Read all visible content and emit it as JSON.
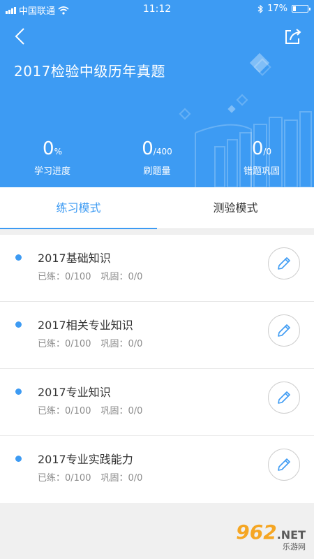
{
  "statusbar": {
    "carrier": "中国联通",
    "time": "11:12",
    "battery": "17%"
  },
  "header": {
    "title": "2017检验中级历年真题",
    "back_icon": "back-chevron-icon",
    "share_icon": "share-icon",
    "stats": [
      {
        "value": "0",
        "unit": "%",
        "label": "学习进度"
      },
      {
        "value": "0",
        "unit": "/400",
        "label": "刷题量"
      },
      {
        "value": "0",
        "unit": "/0",
        "label": "错题巩固"
      }
    ]
  },
  "tabs": [
    {
      "label": "练习模式",
      "active": true
    },
    {
      "label": "测验模式",
      "active": false
    }
  ],
  "items": [
    {
      "title": "2017基础知识",
      "practiced": "已练：0/100",
      "consolidated": "巩固：0/0"
    },
    {
      "title": "2017相关专业知识",
      "practiced": "已练：0/100",
      "consolidated": "巩固：0/0"
    },
    {
      "title": " 2017专业知识",
      "practiced": "已练：0/100",
      "consolidated": "巩固：0/0"
    },
    {
      "title": " 2017专业实践能力",
      "practiced": "已练：0/100",
      "consolidated": "巩固：0/0"
    }
  ],
  "watermark": {
    "brand": "962",
    "suffix": ".NET",
    "sub": "乐游网"
  },
  "colors": {
    "primary": "#3d9bf3",
    "background": "#f0f0f0"
  }
}
